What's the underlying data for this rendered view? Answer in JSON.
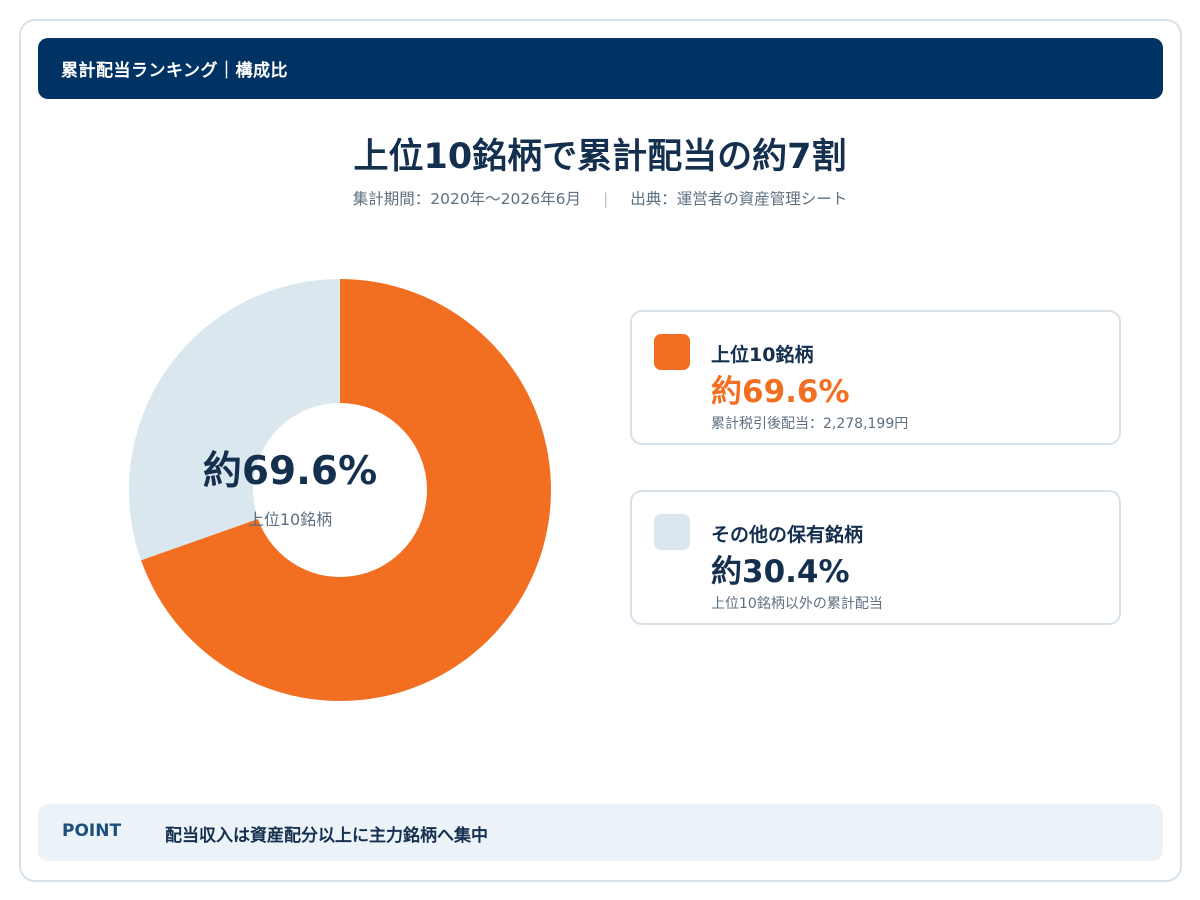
{
  "header": {
    "title": "累計配当ランキング｜構成比"
  },
  "main": {
    "title": "上位10銘柄で累計配当の約7割",
    "period": "集計期間：2020年〜2026年6月",
    "separator": "|",
    "source": "出典：運営者の資産管理シート"
  },
  "center": {
    "value": "約69.6%",
    "label": "上位10銘柄"
  },
  "legend": [
    {
      "name": "上位10銘柄",
      "pct": "約69.6%",
      "desc": "累計税引後配当：2,278,199円",
      "color": "#f26f22"
    },
    {
      "name": "その他の保有銘柄",
      "pct": "約30.4%",
      "desc": "上位10銘柄以外の累計配当",
      "color": "#dae7ef"
    }
  ],
  "point": {
    "label": "POINT",
    "text": "配当収入は資産配分以上に主力銘柄へ集中"
  },
  "chart_data": {
    "type": "pie",
    "categories": [
      "上位10銘柄",
      "その他の保有銘柄"
    ],
    "values": [
      69.6,
      30.4
    ],
    "colors": [
      "#f26f22",
      "#dae7ef"
    ]
  }
}
